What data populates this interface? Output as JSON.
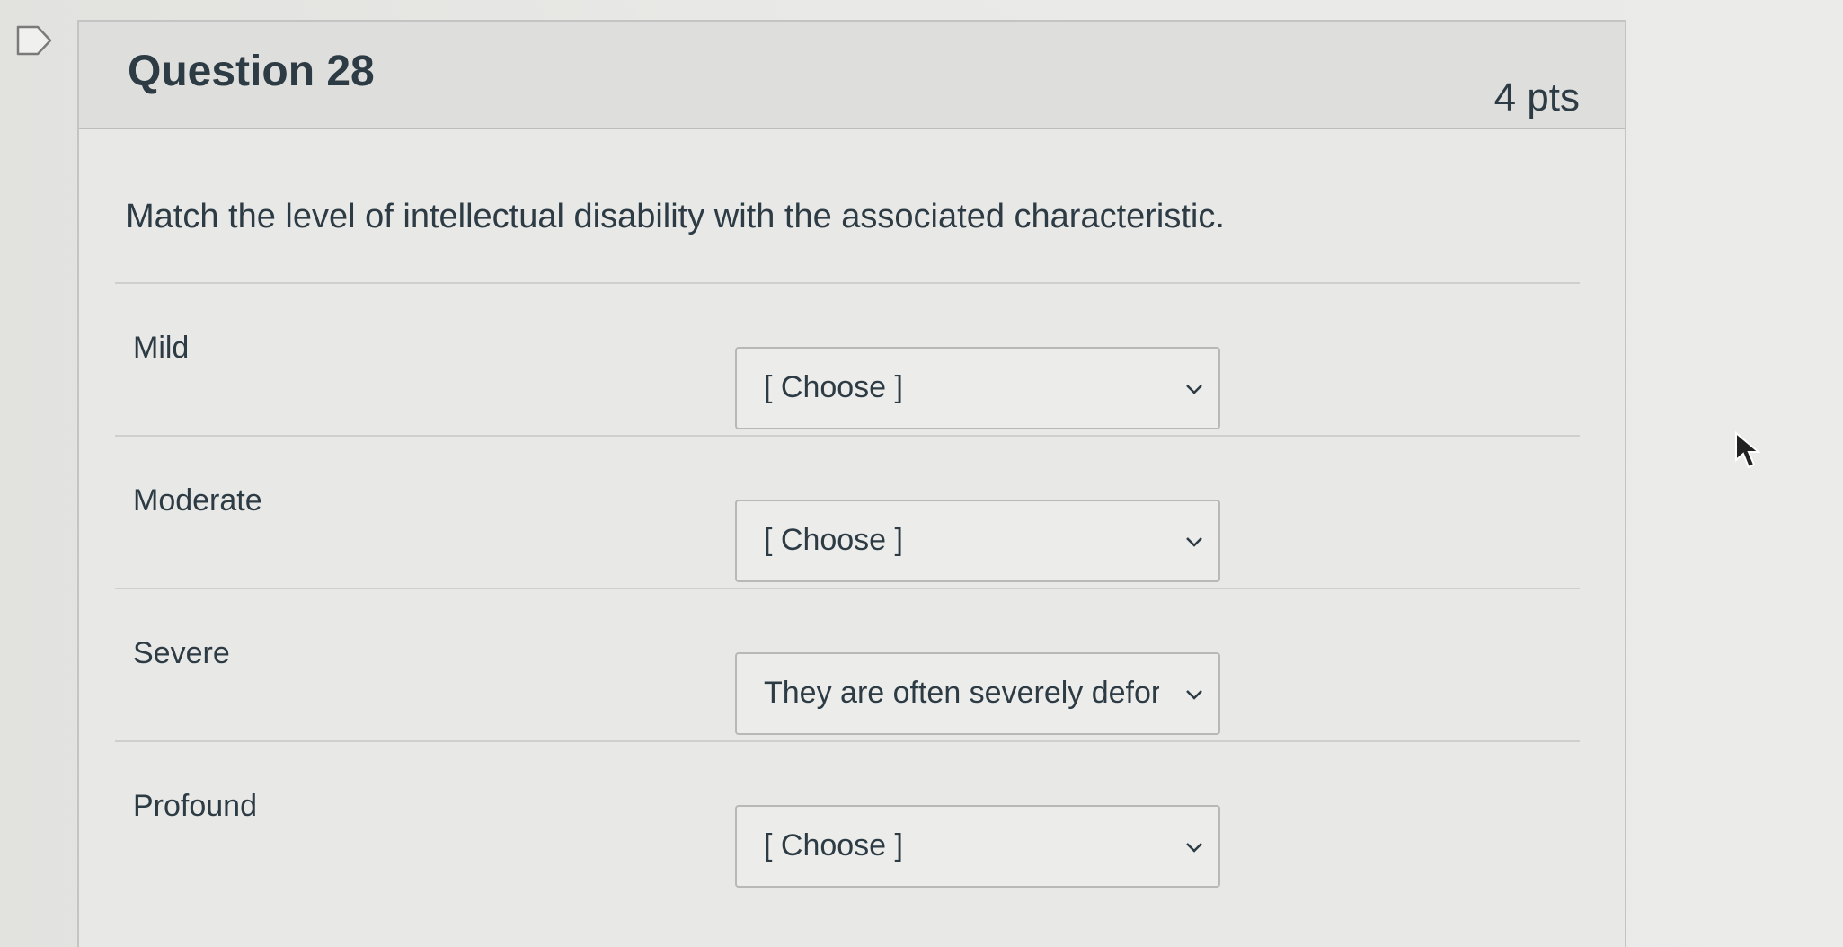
{
  "question": {
    "title": "Question 28",
    "points": "4 pts",
    "prompt": "Match the level of intellectual disability with the associated characteristic."
  },
  "rows": [
    {
      "label": "Mild",
      "selected": "[ Choose ]"
    },
    {
      "label": "Moderate",
      "selected": "[ Choose ]"
    },
    {
      "label": "Severe",
      "selected": "They are often severely defor"
    },
    {
      "label": "Profound",
      "selected": "[ Choose ]"
    }
  ],
  "icons": {
    "flag": "flag-icon",
    "dropdown": "chevron-down-icon",
    "cursor": "mouse-pointer-icon"
  }
}
